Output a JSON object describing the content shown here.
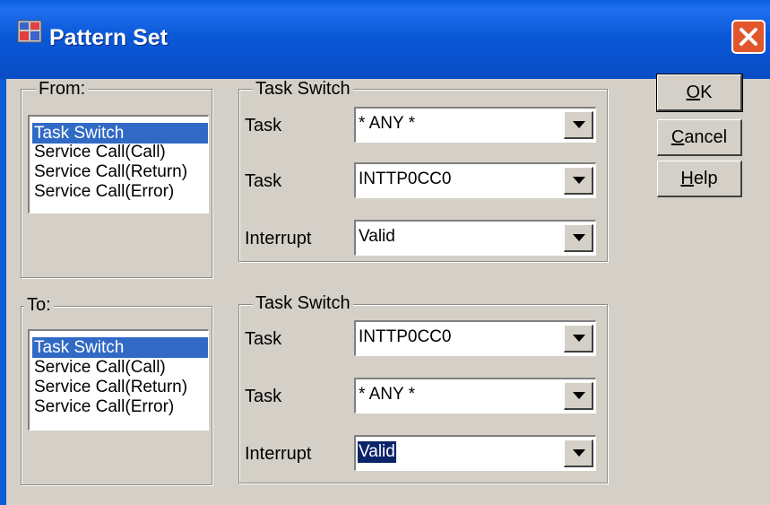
{
  "window": {
    "title": "Pattern Set",
    "icon": "pattern-set-app-icon",
    "close_icon": "close-icon"
  },
  "from": {
    "group_label": "From:",
    "items": [
      "Task Switch",
      "Service Call(Call)",
      "Service Call(Return)",
      "Service Call(Error)"
    ],
    "selected_index": 0,
    "detail": {
      "group_label": "Task Switch",
      "rows": [
        {
          "label": "Task",
          "value": "* ANY *"
        },
        {
          "label": "Task",
          "value": "INTTP0CC0"
        },
        {
          "label": "Interrupt",
          "value": "Valid"
        }
      ]
    }
  },
  "to": {
    "group_label": "To:",
    "items": [
      "Task Switch",
      "Service Call(Call)",
      "Service Call(Return)",
      "Service Call(Error)"
    ],
    "selected_index": 0,
    "detail": {
      "group_label": "Task Switch",
      "rows": [
        {
          "label": "Task",
          "value": "INTTP0CC0"
        },
        {
          "label": "Task",
          "value": "* ANY *"
        },
        {
          "label": "Interrupt",
          "value": "Valid"
        }
      ]
    }
  },
  "buttons": {
    "ok": {
      "mnemonic": "O",
      "rest": "K"
    },
    "cancel": {
      "mnemonic": "C",
      "rest": "ancel"
    },
    "help": {
      "mnemonic": "H",
      "rest": "elp"
    }
  },
  "colors": {
    "title_bar": "#0b59d8",
    "selection": "#316ac5",
    "dialog_face": "#d4d0c8",
    "close_button": "#e2562c"
  }
}
